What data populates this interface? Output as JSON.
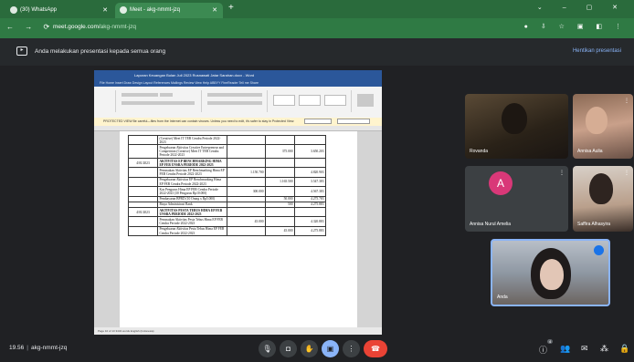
{
  "browser": {
    "tabs": [
      {
        "label": "(30) WhatsApp"
      },
      {
        "label": "Meet - akg-nmmt-jzq"
      }
    ],
    "url": {
      "host": "meet.google.com/",
      "path": "akg-nmmt-jzq"
    }
  },
  "notice": {
    "text": "Anda melakukan presentasi kepada semua orang",
    "stop_label": "Hentikan presentasi"
  },
  "presentation": {
    "word_title": "Laporan Keuangan Bulan Juli 2023 Rusnawati Jatar Sarahan.docx - Word",
    "menu": "File  Home  Insert  Draw  Design  Layout  References  Mailings  Review  View  Help  ABBYY FineReader  Tell me  Share",
    "warning": "PROTECTED VIEW  Be careful—files from the Internet can contain viruses. Unless you need to edit, it's safer to stay in Protected View.",
    "warning_btn1": "",
    "warning_btn2": "",
    "status": "Page 10 of 13    3434 words    English (Indonesia)",
    "table_rows": [
      {
        "date": "",
        "desc": "(Creative) Meet IT TEB Cendra Periode 2022-2023",
        "c1": "",
        "c2": "",
        "c3": "",
        "bold": false
      },
      {
        "date": "",
        "desc": "Pengeluaran Aktivitas Creative Entrepreneur and Competition (Creative) Meet IT TEB Cendra Periode 2022-2023",
        "c1": "",
        "c2": "375.000",
        "c3": "3.650.203",
        "bold": false
      },
      {
        "date": "4/01/2023",
        "desc": "AKTIVITAS EP BENCHMARKING HIMA EP FEB UNSRA PERIODE 2022-2023",
        "c1": "",
        "c2": "",
        "c3": "",
        "bold": true
      },
      {
        "date": "",
        "desc": "Pemasukan Aktivitas EP Benchmarking Hima EP FEB Cendra Periode 2022-2023",
        "c1": "1.150.700",
        "c2": "",
        "c3": "4.820.903",
        "bold": false
      },
      {
        "date": "",
        "desc": "Pengeluaran Aktivitas EP Benchmarking Hima EP FEB Cendra Periode 2022-2023",
        "c1": "",
        "c2": "1.165.500",
        "c3": "3.547.383",
        "bold": false
      },
      {
        "date": "",
        "desc": "Kas Pengurus Hima EP FEB Cendra Periode 2022-2023 (30 Pengurus Rp10.000)",
        "c1": "300.000",
        "c2": "",
        "c3": "4.567.383",
        "bold": false
      },
      {
        "date": "",
        "desc": "Pembayaran BPRD (10 Orang x Rp5.000)",
        "c1": "",
        "c2": "50.000",
        "c3": "4.275.783",
        "bold": false
      },
      {
        "date": "",
        "desc": "Biaya Administrasi Bank",
        "c1": "",
        "c2": "500",
        "c3": "4.275.883",
        "bold": false
      },
      {
        "date": "4/01/2023",
        "desc": "AKTIVITAS PESTA TEBUS HIMA EP FEB UNSRA PERIODE 2022-2023",
        "c1": "",
        "c2": "",
        "c3": "",
        "bold": true
      },
      {
        "date": "",
        "desc": "Pemasukan Aktivitas Pesta Tebus Hima EP FEB Cendra Periode 2022-2023",
        "c1": "45.000",
        "c2": "",
        "c3": "4.320.883",
        "bold": false
      },
      {
        "date": "",
        "desc": "Pengeluaran Aktivitas Pesta Tebus Hima EP FEB Cendra Periode 2022-2023",
        "c1": "",
        "c2": "45.000",
        "c3": "4.275.883",
        "bold": false
      }
    ]
  },
  "participants": [
    {
      "name": "Rovanda"
    },
    {
      "name": "Annisa Aulia"
    },
    {
      "name": "Annisa Nurul Amelia",
      "initial": "A"
    },
    {
      "name": "Saffira Alhasyira"
    },
    {
      "name": "Anda"
    }
  ],
  "bottom": {
    "time": "19.56",
    "separator": "|",
    "code": "akg-nmmt-jzq",
    "mic_icon": "mic-icon",
    "cam_icon": "camera-icon",
    "badge": "4"
  },
  "colors": {
    "tab_bar": "#2a6b3c",
    "end_call": "#ea4335",
    "accent": "#8ab4f8",
    "word_blue": "#2b579a"
  }
}
